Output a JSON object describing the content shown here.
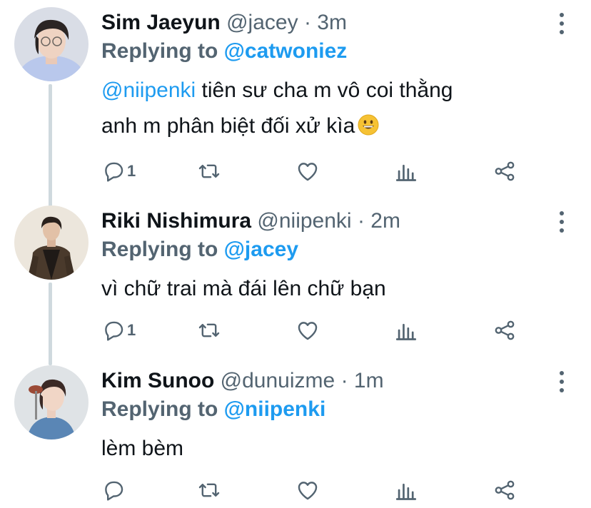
{
  "colors": {
    "accent": "#1d9bf0",
    "muted": "#536471",
    "text": "#0f1419",
    "thread_line": "#cfd9de"
  },
  "icons": [
    "reply-icon",
    "retweet-icon",
    "like-icon",
    "views-icon",
    "share-icon",
    "more-icon",
    "emoji-grinning-icon"
  ],
  "tweets": [
    {
      "name": "Sim Jaeyun",
      "handle": "@jacey",
      "dot": "·",
      "time": "3m",
      "replying_prefix": "Replying to ",
      "replying_to": "@catwoniez",
      "mention": "@niipenki",
      "text_line1": " tiên sư cha m vô coi thằng",
      "text_line2": "anh m phân biệt đối xử kìa",
      "reply_count": "1"
    },
    {
      "name": "Riki Nishimura",
      "handle": "@niipenki",
      "dot": "·",
      "time": "2m",
      "replying_prefix": "Replying to ",
      "replying_to": "@jacey",
      "text": "vì chữ trai mà đái lên chữ bạn",
      "reply_count": "1"
    },
    {
      "name": "Kim Sunoo",
      "handle": "@dunuizme",
      "dot": "·",
      "time": "1m",
      "replying_prefix": "Replying to ",
      "replying_to": "@niipenki",
      "text": "lèm bèm",
      "reply_count": ""
    }
  ]
}
